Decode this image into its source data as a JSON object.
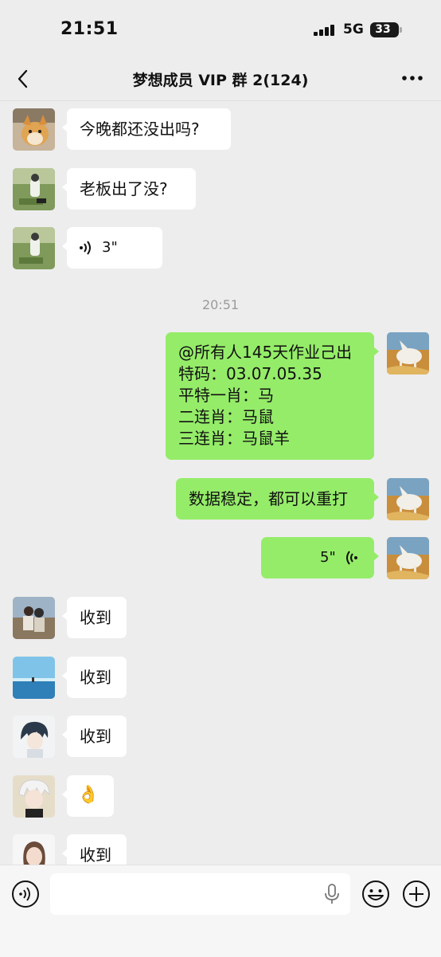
{
  "status_bar": {
    "time": "21:51",
    "network": "5G",
    "battery": "33"
  },
  "header": {
    "title": "梦想成员 VIP 群 2(124)"
  },
  "messages": [
    {
      "side": "left",
      "text": "今晚都还没出吗?"
    },
    {
      "side": "left",
      "text": "老板出了没?"
    },
    {
      "side": "left",
      "voice_duration": "3\""
    },
    {
      "timestamp": "20:51"
    },
    {
      "side": "right",
      "lines": [
        "@所有人145天作业己出",
        "特码：03.07.05.35",
        "平特一肖：马",
        "二连肖：马鼠",
        "三连肖：马鼠羊"
      ]
    },
    {
      "side": "right",
      "text": "数据稳定，都可以重打"
    },
    {
      "side": "right",
      "voice_duration": "5\""
    },
    {
      "side": "left",
      "text": "收到"
    },
    {
      "side": "left",
      "text": "收到"
    },
    {
      "side": "left",
      "text": "收到"
    },
    {
      "side": "left",
      "text": "👌"
    },
    {
      "side": "left",
      "text": "收到"
    }
  ],
  "colors": {
    "sent_bubble": "#95EC69",
    "background": "#EDEDED",
    "received_bubble": "#FFFFFF"
  },
  "icons": [
    "back-icon",
    "more-icon",
    "voice-wave-icon",
    "voice-input-icon",
    "microphone-icon",
    "emoji-icon",
    "plus-icon"
  ]
}
